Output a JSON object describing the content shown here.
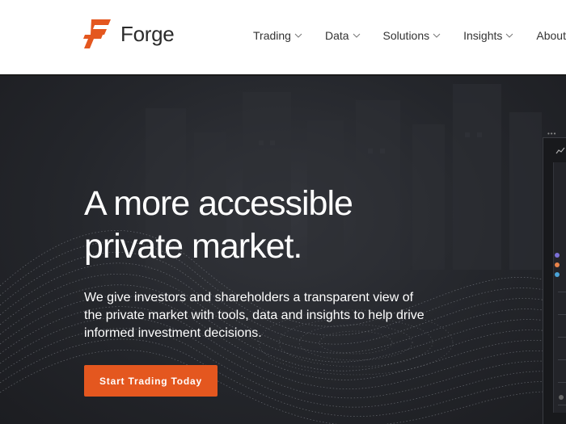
{
  "brand": {
    "name": "Forge",
    "accent": "#e4571f"
  },
  "nav": {
    "items": [
      {
        "label": "Trading"
      },
      {
        "label": "Data"
      },
      {
        "label": "Solutions"
      },
      {
        "label": "Insights"
      },
      {
        "label": "About"
      }
    ]
  },
  "hero": {
    "headline_line1": "A more accessible",
    "headline_line2": "private market.",
    "subtext": "We give investors and shareholders a transparent view of the private market with tools, data and insights to help drive informed investment decisions.",
    "cta_label": "Start Trading Today"
  },
  "preview": {
    "dots": "•••",
    "legend_colors": [
      "#7b6fd6",
      "#e8834a",
      "#4aa3d8"
    ]
  }
}
